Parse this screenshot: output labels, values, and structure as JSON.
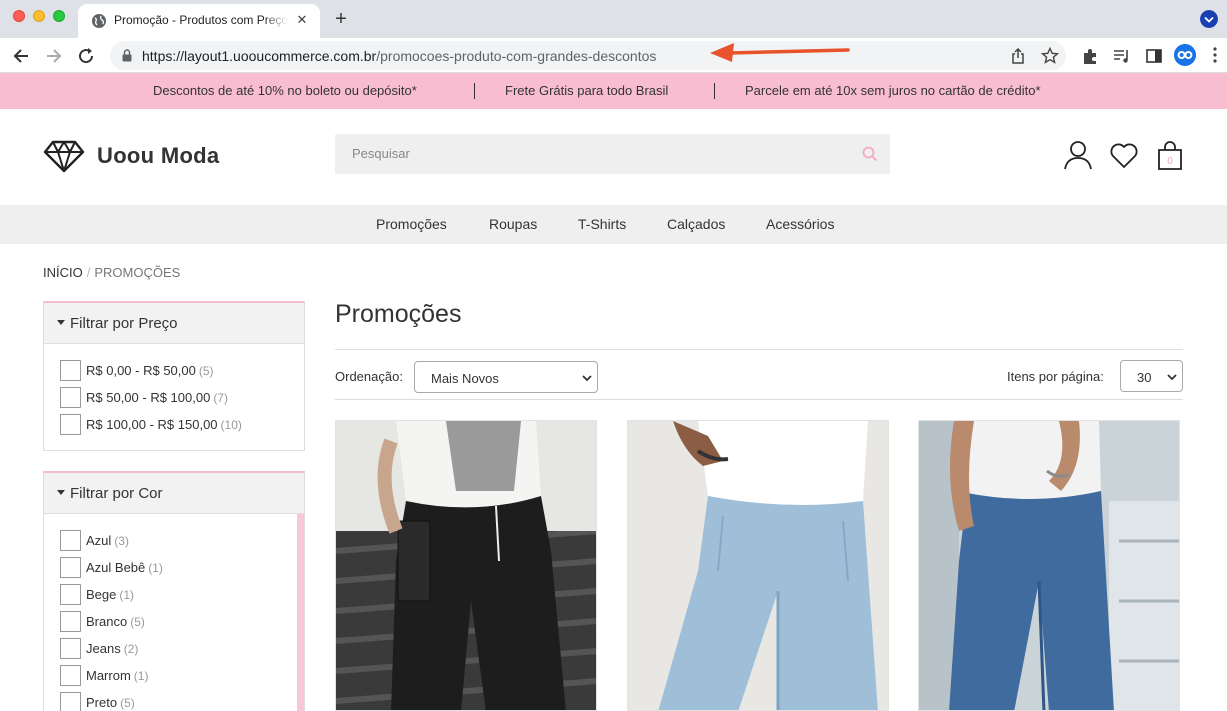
{
  "browser": {
    "tab_title": "Promoção - Produtos com Preços Incríveis",
    "tab_close": "✕",
    "new_tab": "+",
    "url_host": "https://layout1.uooucommerce.com.br",
    "url_path": "/promocoes-produto-com-grandes-descontos"
  },
  "promo_bar": {
    "items": [
      "Descontos de até 10% no boleto ou depósito*",
      "Frete Grátis para todo Brasil",
      "Parcele em até 10x sem juros no cartão de crédito*"
    ],
    "background": "#f8bdd0"
  },
  "header": {
    "logo_text": "Uoou Moda",
    "search_placeholder": "Pesquisar",
    "cart_count": "0"
  },
  "category_nav": [
    "Promoções",
    "Roupas",
    "T-Shirts",
    "Calçados",
    "Acessórios"
  ],
  "breadcrumb": {
    "home": "INÍCIO",
    "separator": "/",
    "current": "PROMOÇÕES"
  },
  "filters": {
    "price": {
      "title": "Filtrar por Preço",
      "options": [
        {
          "label": "R$ 0,00 - R$ 50,00",
          "count": "(5)"
        },
        {
          "label": "R$ 50,00 - R$ 100,00",
          "count": "(7)"
        },
        {
          "label": "R$ 100,00 - R$ 150,00",
          "count": "(10)"
        }
      ]
    },
    "color": {
      "title": "Filtrar por Cor",
      "options": [
        {
          "label": "Azul",
          "count": "(3)"
        },
        {
          "label": "Azul Bebê",
          "count": "(1)"
        },
        {
          "label": "Bege",
          "count": "(1)"
        },
        {
          "label": "Branco",
          "count": "(5)"
        },
        {
          "label": "Jeans",
          "count": "(2)"
        },
        {
          "label": "Marrom",
          "count": "(1)"
        },
        {
          "label": "Preto",
          "count": "(5)"
        }
      ]
    }
  },
  "main": {
    "title": "Promoções",
    "sort_label": "Ordenação:",
    "sort_value": "Mais Novos",
    "per_page_label": "Itens por página:",
    "per_page_value": "30"
  },
  "products": [
    {
      "image": "black-cargo-pants-photo"
    },
    {
      "image": "light-blue-jeans-photo"
    },
    {
      "image": "blue-jeans-photo"
    }
  ],
  "colors": {
    "accent_pink": "#f3bcd0",
    "gray_bg": "#efefef"
  }
}
